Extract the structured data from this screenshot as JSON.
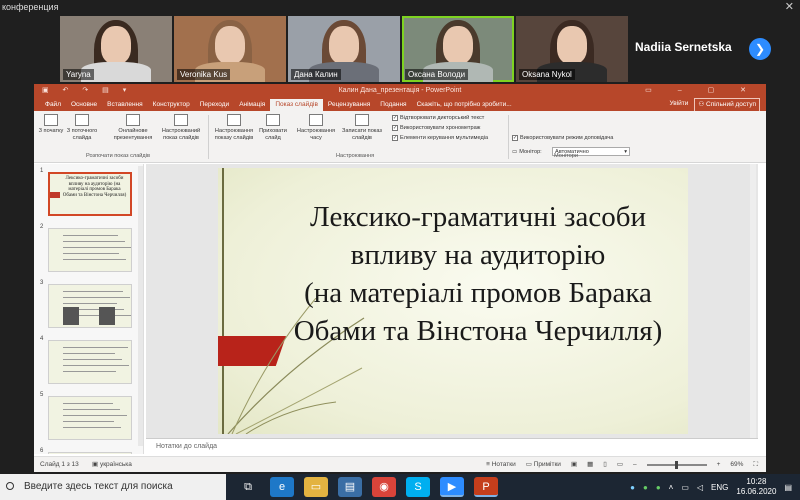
{
  "zoom": {
    "window_title": "конференция",
    "participants": [
      {
        "name": "Yaryna",
        "bg": "#8a8076",
        "hair": "#3a2a20",
        "shirt": "#d9d9d9",
        "active": false
      },
      {
        "name": "Veronika Kus",
        "bg": "#a2704d",
        "hair": "#8a6244",
        "shirt": "#c8a07a",
        "active": false
      },
      {
        "name": "Дана Калин",
        "bg": "#9aa0a8",
        "hair": "#6b4a36",
        "shirt": "#6b6f78",
        "active": false
      },
      {
        "name": "Оксана Володи",
        "bg": "#7c8a7a",
        "hair": "#4a3a2c",
        "shirt": "#b0b8b4",
        "active": true
      },
      {
        "name": "Oksana Nykol",
        "bg": "#57453c",
        "hair": "#3b2a22",
        "shirt": "#2c2c2c",
        "active": false
      }
    ],
    "self_name": "Nadiia Sernetska",
    "next_icon": "chevron-right"
  },
  "ppt": {
    "doc_title": "Калин Дана_презентація - PowerPoint",
    "tabs": [
      "Файл",
      "Основне",
      "Вставлення",
      "Конструктор",
      "Переходи",
      "Анімація",
      "Показ слайдів",
      "Рецензування",
      "Подання",
      "Скажіть, що потрібно зробити..."
    ],
    "selected_tab": "Показ слайдів",
    "signin": "Увійти",
    "share": "Спільний доступ",
    "ribbon": {
      "btn_from_start": "З початку",
      "btn_from_current": "З поточного слайда",
      "btn_online": "Онлайнове презентування",
      "btn_custom": "Настроюваний показ слайдів",
      "group_start": "Розпочати показ слайдів",
      "btn_setup": "Настроювання показу слайдів",
      "btn_hide": "Приховати слайд",
      "btn_rehearse": "Настроювання часу",
      "btn_record": "Записати показ слайдів",
      "chk_narrations": "Відтворювати дикторський текст",
      "chk_timings": "Використовувати хронометраж",
      "chk_media": "Елементи керування мультимедіа",
      "group_setup": "Настроювання",
      "monitor_label": "Монітор:",
      "monitor_value": "Автоматично",
      "chk_presenter": "Використовувати режим доповідача",
      "group_monitors": "Монітори"
    },
    "thumbnails": [
      {
        "num": "1",
        "text": "Лексико-граматичні засоби впливу на аудиторію (на матеріалі промов Барака Обами та Вінстона Черчилля)"
      },
      {
        "num": "2",
        "text": ""
      },
      {
        "num": "3",
        "text": ""
      },
      {
        "num": "4",
        "text": ""
      },
      {
        "num": "5",
        "text": ""
      },
      {
        "num": "6",
        "text": ""
      }
    ],
    "slide_title_lines": [
      "Лексико-граматичні засоби",
      "впливу на аудиторію",
      "(на матеріалі промов Барака",
      "Обами та Вінстона Черчилля)"
    ],
    "notes_placeholder": "Нотатки до слайда",
    "status": {
      "slide_counter": "Слайд 1 з 13",
      "language": "українська",
      "notes": "Нотатки",
      "comments": "Примітки",
      "zoom": "69%"
    }
  },
  "taskbar": {
    "search_placeholder": "Введите здесь текст для поиска",
    "apps": [
      "task-view",
      "edge",
      "explorer",
      "store",
      "chrome",
      "skype",
      "zoom",
      "powerpoint"
    ],
    "lang": "ENG",
    "time": "10:28",
    "date": "16.06.2020"
  }
}
